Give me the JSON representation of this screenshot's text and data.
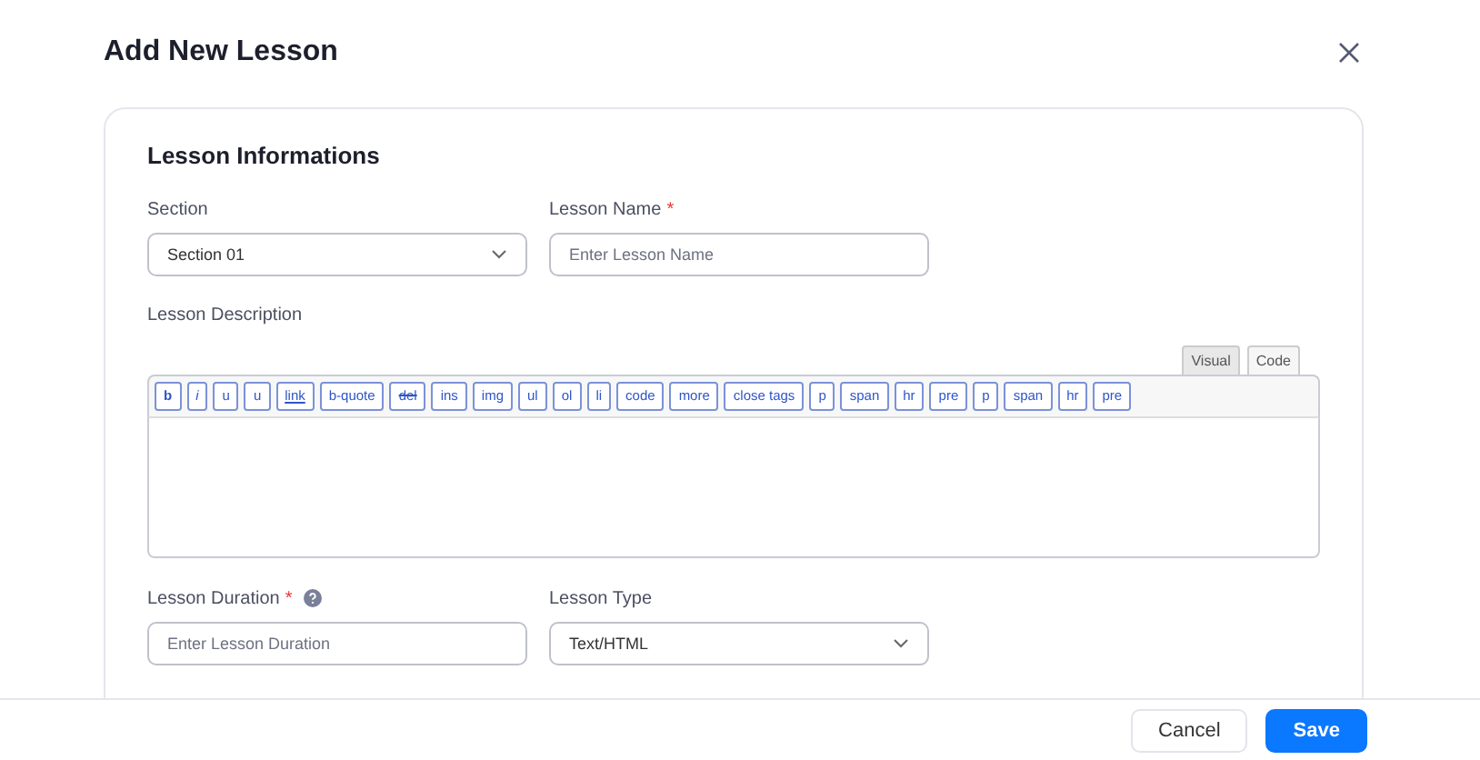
{
  "dialog": {
    "title": "Add New Lesson"
  },
  "card": {
    "heading": "Lesson Informations",
    "row_1": [
      {
        "kind": "select",
        "label": "Section",
        "help": false,
        "value": "Section 01"
      },
      {
        "kind": "input",
        "label": "Lesson Name",
        "required_mark": "*",
        "help": false,
        "placeholder": "Enter Lesson Name"
      }
    ],
    "description": {
      "label": "Lesson Description",
      "tabs": [
        {
          "label": "Visual",
          "selected": true
        },
        {
          "label": "Code",
          "selected": false
        }
      ],
      "toolbar": [
        {
          "label": "b",
          "kind": "bold"
        },
        {
          "label": "i",
          "kind": "italic"
        },
        {
          "label": "u",
          "kind": "plain"
        },
        {
          "label": "u",
          "kind": "plain"
        },
        {
          "label": "link",
          "kind": "underline"
        },
        {
          "label": "b-quote",
          "kind": "plain"
        },
        {
          "label": "del",
          "kind": "strike"
        },
        {
          "label": "ins",
          "kind": "plain"
        },
        {
          "label": "img",
          "kind": "plain"
        },
        {
          "label": "ul",
          "kind": "plain"
        },
        {
          "label": "ol",
          "kind": "plain"
        },
        {
          "label": "li",
          "kind": "plain"
        },
        {
          "label": "code",
          "kind": "plain"
        },
        {
          "label": "more",
          "kind": "plain"
        },
        {
          "label": "close tags",
          "kind": "plain"
        },
        {
          "label": "p",
          "kind": "plain"
        },
        {
          "label": "span",
          "kind": "plain"
        },
        {
          "label": "hr",
          "kind": "plain"
        },
        {
          "label": "pre",
          "kind": "plain"
        },
        {
          "label": "p",
          "kind": "plain"
        },
        {
          "label": "span",
          "kind": "plain"
        },
        {
          "label": "hr",
          "kind": "plain"
        },
        {
          "label": "pre",
          "kind": "plain"
        }
      ]
    },
    "row_2": [
      {
        "kind": "input",
        "label": "Lesson Duration",
        "required_mark": "*",
        "help": true,
        "placeholder": "Enter Lesson Duration"
      },
      {
        "kind": "select",
        "label": "Lesson Type",
        "help": false,
        "value": "Text/HTML"
      }
    ]
  },
  "footer": {
    "buttons": [
      {
        "label": "Cancel",
        "kind": "secondary"
      },
      {
        "label": "Save",
        "kind": "primary"
      }
    ]
  }
}
